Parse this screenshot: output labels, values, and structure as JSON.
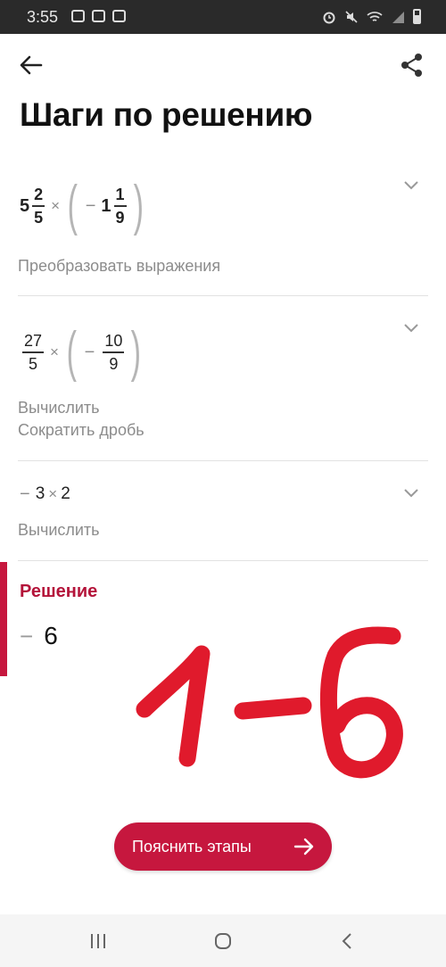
{
  "status_bar": {
    "time": "3:55"
  },
  "header": {
    "title": "Шаги по решению"
  },
  "steps": [
    {
      "expression": {
        "whole": "5",
        "n1": "2",
        "d1": "5",
        "times": "×",
        "minus": "−",
        "whole2": "1",
        "n2": "1",
        "d2": "9"
      },
      "desc": [
        "Преобразовать выражения"
      ]
    },
    {
      "expression": {
        "n1": "27",
        "d1": "5",
        "times": "×",
        "minus": "−",
        "n2": "10",
        "d2": "9"
      },
      "desc": [
        "Вычислить",
        "Сократить дробь"
      ]
    },
    {
      "expression": {
        "minus": "−",
        "a": "3",
        "times": "×",
        "b": "2"
      },
      "desc": [
        "Вычислить"
      ]
    }
  ],
  "solution": {
    "title": "Решение",
    "minus": "−",
    "value": "6"
  },
  "handwritten_note": "1-б",
  "explain_button": {
    "label": "Пояснить этапы"
  },
  "colors": {
    "accent": "#c6173e",
    "status_bar": "#2a2a2a",
    "muted_text": "#8c8c8c"
  },
  "icons": [
    "back-arrow-icon",
    "share-icon",
    "chevron-down-icon",
    "arrow-right-icon",
    "recent-apps-icon",
    "home-icon",
    "back-icon"
  ]
}
